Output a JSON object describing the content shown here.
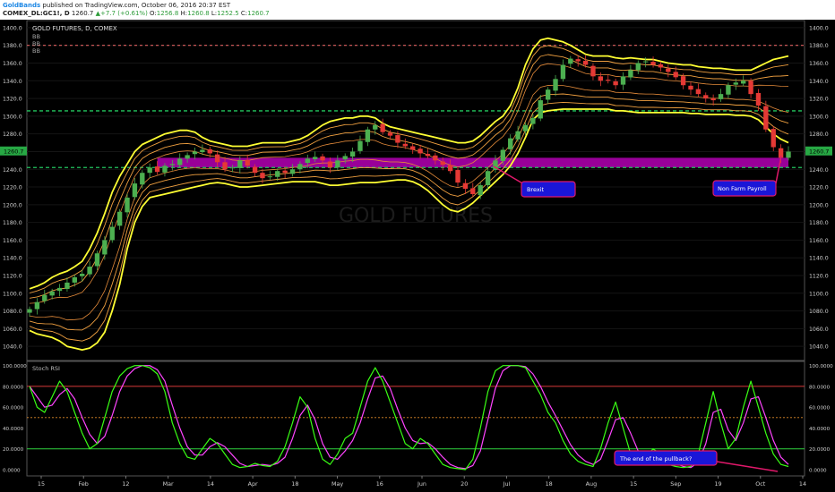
{
  "header": {
    "publisher": "GoldBands",
    "published_on": "published on TradingView.com, October 06, 2016 20:37 EST",
    "symbol": "COMEX_DL:GC1!, D",
    "last": "1260.7",
    "change": "+7.7 (+0.61%)",
    "o_label": "O:",
    "open": "1256.8",
    "h_label": "H:",
    "high": "1260.8",
    "l_label": "L:",
    "low": "1252.5",
    "c_label": "C:",
    "close": "1260.7"
  },
  "panel_legend": {
    "title": "GOLD FUTURES, D, COMEX",
    "indicators": [
      "BB",
      "BB",
      "BB"
    ]
  },
  "watermark": "GOLD FUTURES",
  "annotations": {
    "brexit": "Brexit",
    "nfp": "Non Farm Payroll",
    "pullback": "The end of the pullback?"
  },
  "colors": {
    "background": "#000000",
    "band": "#ffff33",
    "inner_band": "#f0a040",
    "zone": "#b400b4",
    "support_line": "#22c55e",
    "resistance_line": "#e06060",
    "stoch_k": "#39ff14",
    "stoch_d": "#ff44ff",
    "callout": "#1a16d8",
    "callout_border": "#e0186a"
  },
  "chart_data": [
    {
      "type": "line",
      "title": "GOLD FUTURES, D, COMEX",
      "price_axis_ticks": [
        1040,
        1060,
        1080,
        1100,
        1120,
        1140,
        1160,
        1180,
        1200,
        1220,
        1240,
        1260,
        1280,
        1300,
        1320,
        1340,
        1360,
        1380,
        1400
      ],
      "ylim": [
        1024,
        1408
      ],
      "x_ticks": [
        "15",
        "Feb",
        "12",
        "Mar",
        "14",
        "Apr",
        "18",
        "May",
        "16",
        "Jun",
        "20",
        "Jul",
        "18",
        "Aug",
        "15",
        "Sep",
        "19",
        "Oct",
        "14"
      ],
      "last_price_label": "1260.7",
      "horizontal_levels": {
        "resistance": 1380,
        "support_upper": 1306,
        "support_lower": 1242
      },
      "zone": [
        1242,
        1253
      ],
      "series": [
        {
          "name": "Close",
          "values": [
            1082,
            1090,
            1098,
            1102,
            1106,
            1112,
            1118,
            1122,
            1130,
            1145,
            1160,
            1175,
            1192,
            1208,
            1224,
            1236,
            1242,
            1237,
            1244,
            1246,
            1252,
            1256,
            1260,
            1262,
            1258,
            1248,
            1240,
            1242,
            1250,
            1244,
            1236,
            1230,
            1232,
            1238,
            1236,
            1240,
            1246,
            1252,
            1254,
            1250,
            1242,
            1250,
            1255,
            1260,
            1272,
            1285,
            1290,
            1282,
            1278,
            1270,
            1266,
            1262,
            1258,
            1255,
            1250,
            1245,
            1238,
            1225,
            1218,
            1212,
            1222,
            1238,
            1250,
            1262,
            1275,
            1283,
            1290,
            1298,
            1318,
            1330,
            1342,
            1358,
            1365,
            1362,
            1358,
            1345,
            1340,
            1340,
            1335,
            1345,
            1352,
            1360,
            1362,
            1358,
            1355,
            1350,
            1344,
            1335,
            1330,
            1325,
            1320,
            1318,
            1325,
            1335,
            1338,
            1340,
            1325,
            1312,
            1285,
            1265,
            1253,
            1260
          ]
        },
        {
          "name": "BB upper",
          "values": [
            1105,
            1108,
            1112,
            1118,
            1122,
            1125,
            1130,
            1136,
            1150,
            1168,
            1190,
            1214,
            1232,
            1246,
            1260,
            1268,
            1272,
            1276,
            1280,
            1282,
            1284,
            1284,
            1282,
            1276,
            1272,
            1270,
            1268,
            1266,
            1266,
            1266,
            1268,
            1270,
            1270,
            1270,
            1270,
            1272,
            1274,
            1278,
            1284,
            1290,
            1294,
            1296,
            1298,
            1298,
            1300,
            1300,
            1298,
            1292,
            1288,
            1286,
            1284,
            1282,
            1280,
            1278,
            1276,
            1274,
            1272,
            1270,
            1270,
            1272,
            1278,
            1286,
            1294,
            1300,
            1312,
            1332,
            1358,
            1376,
            1386,
            1388,
            1386,
            1384,
            1380,
            1375,
            1370,
            1368,
            1368,
            1368,
            1366,
            1365,
            1366,
            1365,
            1364,
            1364,
            1362,
            1360,
            1359,
            1358,
            1358,
            1356,
            1355,
            1354,
            1354,
            1353,
            1352,
            1352,
            1352,
            1356,
            1360,
            1364,
            1366,
            1368
          ]
        },
        {
          "name": "BB lower",
          "values": [
            1058,
            1054,
            1052,
            1050,
            1046,
            1040,
            1038,
            1036,
            1038,
            1044,
            1056,
            1080,
            1110,
            1150,
            1180,
            1198,
            1208,
            1210,
            1212,
            1214,
            1216,
            1218,
            1220,
            1222,
            1224,
            1225,
            1224,
            1222,
            1220,
            1220,
            1221,
            1222,
            1223,
            1224,
            1225,
            1226,
            1226,
            1226,
            1226,
            1224,
            1222,
            1222,
            1223,
            1224,
            1225,
            1225,
            1225,
            1226,
            1227,
            1228,
            1228,
            1226,
            1222,
            1216,
            1208,
            1200,
            1194,
            1192,
            1196,
            1202,
            1210,
            1218,
            1226,
            1234,
            1244,
            1258,
            1276,
            1296,
            1304,
            1306,
            1307,
            1308,
            1308,
            1308,
            1308,
            1308,
            1308,
            1308,
            1306,
            1306,
            1305,
            1304,
            1304,
            1304,
            1304,
            1304,
            1304,
            1304,
            1303,
            1303,
            1302,
            1302,
            1302,
            1302,
            1301,
            1301,
            1300,
            1296,
            1288,
            1280,
            1274,
            1270
          ]
        }
      ]
    },
    {
      "type": "line",
      "title": "Stoch RSI",
      "ylim": [
        -6,
        104
      ],
      "y_ticks": [
        "100.0000",
        "80.0000",
        "60.0000",
        "40.0000",
        "20.0000",
        "0.0000"
      ],
      "levels": {
        "overbought": 80,
        "mid": 50,
        "oversold": 20
      },
      "series": [
        {
          "name": "K",
          "values": [
            80,
            60,
            55,
            70,
            85,
            75,
            55,
            35,
            20,
            25,
            50,
            75,
            90,
            97,
            100,
            100,
            98,
            92,
            75,
            45,
            25,
            12,
            10,
            20,
            30,
            25,
            15,
            5,
            2,
            3,
            6,
            4,
            3,
            8,
            22,
            45,
            70,
            60,
            30,
            10,
            5,
            15,
            30,
            35,
            60,
            85,
            98,
            85,
            65,
            45,
            25,
            20,
            30,
            25,
            15,
            5,
            2,
            1,
            0,
            10,
            40,
            75,
            95,
            100,
            100,
            100,
            98,
            85,
            72,
            55,
            45,
            28,
            15,
            8,
            5,
            3,
            20,
            45,
            65,
            40,
            15,
            5,
            12,
            20,
            15,
            5,
            3,
            2,
            3,
            15,
            45,
            75,
            45,
            20,
            30,
            60,
            85,
            60,
            35,
            15,
            5,
            3
          ]
        },
        {
          "name": "D",
          "values": [
            80,
            70,
            60,
            62,
            72,
            78,
            68,
            50,
            34,
            25,
            32,
            52,
            75,
            90,
            97,
            100,
            100,
            96,
            85,
            62,
            40,
            22,
            14,
            14,
            22,
            26,
            22,
            14,
            6,
            3,
            4,
            5,
            4,
            6,
            12,
            30,
            52,
            62,
            48,
            25,
            12,
            10,
            18,
            28,
            45,
            68,
            88,
            90,
            78,
            58,
            40,
            28,
            25,
            26,
            20,
            12,
            5,
            2,
            1,
            4,
            18,
            48,
            78,
            95,
            100,
            100,
            99,
            92,
            80,
            65,
            52,
            38,
            24,
            14,
            8,
            5,
            10,
            28,
            48,
            50,
            35,
            18,
            10,
            14,
            15,
            10,
            6,
            3,
            2,
            7,
            25,
            55,
            58,
            38,
            28,
            45,
            68,
            70,
            50,
            28,
            12,
            5
          ]
        }
      ]
    }
  ]
}
